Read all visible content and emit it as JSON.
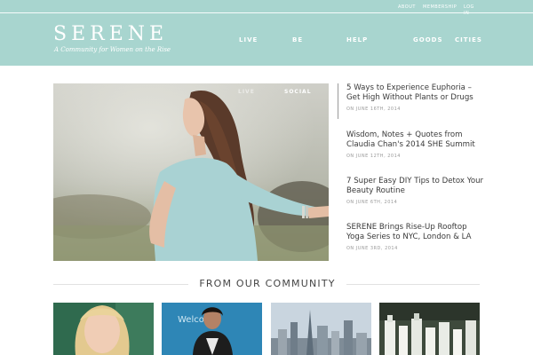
{
  "utility_nav": {
    "about": "ABOUT",
    "membership": "MEMBERSHIP",
    "login": "LOG IN"
  },
  "brand": {
    "logo": "SERENE",
    "tagline": "A Community for Women on the Rise"
  },
  "main_nav": [
    "LIVE",
    "BE",
    "HELP",
    "GOODS",
    "CITIES"
  ],
  "hero": {
    "tabs": [
      "LIVE",
      "SOCIAL"
    ]
  },
  "articles": [
    {
      "title": "5 Ways to Experience Euphoria – Get High Without Plants or Drugs",
      "date": "ON JUNE 16TH, 2014"
    },
    {
      "title": "Wisdom, Notes + Quotes from Claudia Chan's 2014 SHE Summit",
      "date": "ON JUNE 12TH, 2014"
    },
    {
      "title": "7 Super Easy DIY Tips to Detox Your Beauty Routine",
      "date": "ON JUNE 6TH, 2014"
    },
    {
      "title": "SERENE Brings Rise-Up Rooftop Yoga Series to NYC, London & LA",
      "date": "ON JUNE 3RD, 2014"
    }
  ],
  "community": {
    "heading": "FROM OUR COMMUNITY",
    "thumb2_sign": "Welco"
  },
  "colors": {
    "header_bg": "#a8d5cf",
    "text": "#3a3a3a",
    "muted": "#9a9a9a"
  }
}
